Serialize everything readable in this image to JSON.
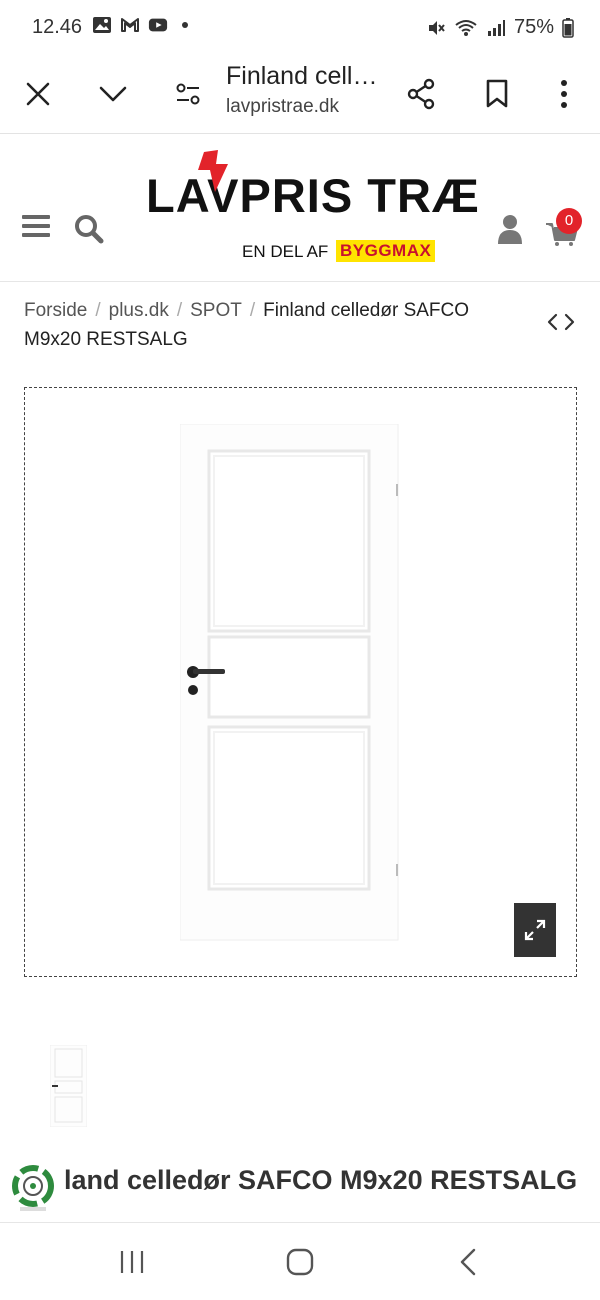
{
  "status_bar": {
    "time": "12.46",
    "battery": "75%",
    "left_icons": [
      "gallery-icon",
      "gmail-icon",
      "youtube-icon"
    ],
    "right_icons": [
      "mute-icon",
      "wifi-icon",
      "signal-icon",
      "battery-icon"
    ]
  },
  "browser": {
    "title": "Finland cell…",
    "url": "lavpristrae.dk",
    "buttons": [
      "close-icon",
      "chevron-down-icon",
      "page-settings-icon",
      "share-icon",
      "bookmark-icon",
      "more-icon"
    ]
  },
  "site_header": {
    "logo_text": "LAVPRIS TRÆ",
    "logo_sub": "EN DEL AF",
    "logo_badge": "BYGGMAX",
    "cart_count": "0",
    "icons": [
      "menu-icon",
      "search-icon",
      "user-icon",
      "cart-icon"
    ]
  },
  "breadcrumb": {
    "items": [
      "Forside",
      "plus.dk",
      "SPOT"
    ],
    "current": "Finland celledør SAFCO M9x20 RESTSALG"
  },
  "product": {
    "title_visible": "land celledør SAFCO M9x20 RESTSALG",
    "image_icons": [
      "door-image",
      "expand-icon"
    ]
  },
  "colors": {
    "brand_red": "#e2232a",
    "brand_yellow": "#ffe400",
    "byggmax_red": "#c8102e",
    "eco_green": "#2e8b3e"
  }
}
